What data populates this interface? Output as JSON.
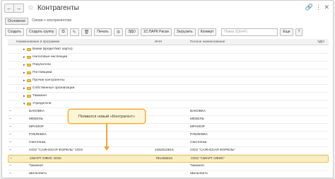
{
  "window": {
    "title": "Контрагенты",
    "back_label": "←",
    "forward_label": "→",
    "star_label": "☆",
    "link_label": "🔗",
    "more_label": "⋮",
    "close_label": "✕"
  },
  "tabs": {
    "main": "Основное",
    "link": "Связи с контрагентом"
  },
  "toolbar": {
    "create": "Создать",
    "create_group": "Создать группу",
    "copy_icon": "⧉",
    "edit_icon": "✎",
    "delete_icon": "🗑",
    "print": "Печать",
    "settings_icon": "⚙",
    "edo": "ЭДО",
    "ul_fl": "1С:ПАРК Риски",
    "upload": "Загрузить",
    "compare": "Конверт",
    "search_placeholder": "Поиск (Ctrl+F)",
    "more": "Еще",
    "help": "?"
  },
  "table": {
    "columns": {
      "name": "Наименование в программе",
      "inn": "ИНН",
      "full": "Полное наименование",
      "edo": "ЭДО"
    },
    "groups": [
      "Банки (кредит/мат карты)",
      "Налоговые инспекции",
      "Покупатели",
      "Поставщики",
      "Прочие контрагенты",
      "Собственные организации",
      "Таможня",
      "Учредители"
    ],
    "items": [
      {
        "name": "БАКОВКА",
        "inn": "",
        "full": "БАКОВКА"
      },
      {
        "name": "МЕБЕЛЬ",
        "inn": "",
        "full": "МЕБЕЛЬ"
      },
      {
        "name": "МРАМОР",
        "inn": "",
        "full": "МРАМОР"
      },
      {
        "name": "РУБЛЕВКА",
        "inn": "",
        "full": "РУБЛЕВКА"
      },
      {
        "name": "Светлянка",
        "inn": "",
        "full": "Светлянка"
      },
      {
        "name": "ООО \"САЯНСКАЯ ФОРЕЛЬ\" ООО",
        "inn": "2462010816",
        "full": "ООО \"САЯНСКАЯ ФОРЕЛЬ\""
      },
      {
        "name": "СМАРТ ОФИС ООО",
        "inn": "781465816",
        "full": "ООО \"СМАРТ ОФИС\""
      },
      {
        "name": "Таможня",
        "inn": "",
        "full": "Таможня"
      },
      {
        "name": "Шильпинть",
        "inn": "",
        "full": "Шильпинть"
      }
    ]
  },
  "callout": {
    "text": "Появился новый «Контрагент»"
  },
  "colors": {
    "selected_row": "#fbeec0",
    "accent": "#f0a23c",
    "primary_button": "#fbed9e"
  }
}
